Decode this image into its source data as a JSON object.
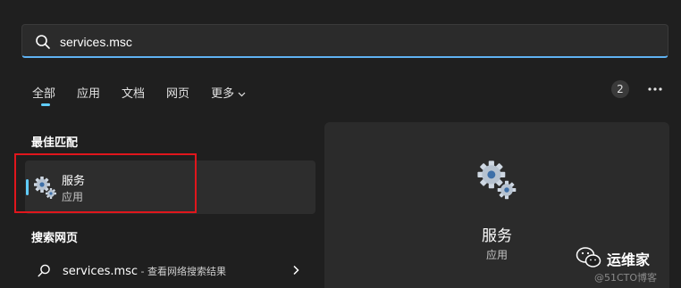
{
  "search": {
    "value": "services.msc"
  },
  "tabs": [
    {
      "label": "全部"
    },
    {
      "label": "应用"
    },
    {
      "label": "文档"
    },
    {
      "label": "网页"
    },
    {
      "label": "更多"
    }
  ],
  "header": {
    "badge_count": "2"
  },
  "best_match": {
    "heading": "最佳匹配",
    "item": {
      "title": "服务",
      "subtitle": "应用"
    }
  },
  "web_search": {
    "heading": "搜索网页",
    "item": {
      "query": "services.msc",
      "suffix": " - 查看网络搜索结果"
    }
  },
  "preview": {
    "title": "服务",
    "subtitle": "应用"
  },
  "watermark": {
    "name": "运维家",
    "source": "@51CTO博客"
  },
  "colors": {
    "accent": "#60cdff",
    "highlight": "#e0161c",
    "background": "#1f1f1f",
    "panel": "#2b2b2b"
  },
  "icons": [
    "search-icon",
    "chevron-down-icon",
    "more-icon",
    "services-gear-icon",
    "chevron-right-icon",
    "wechat-logo"
  ]
}
